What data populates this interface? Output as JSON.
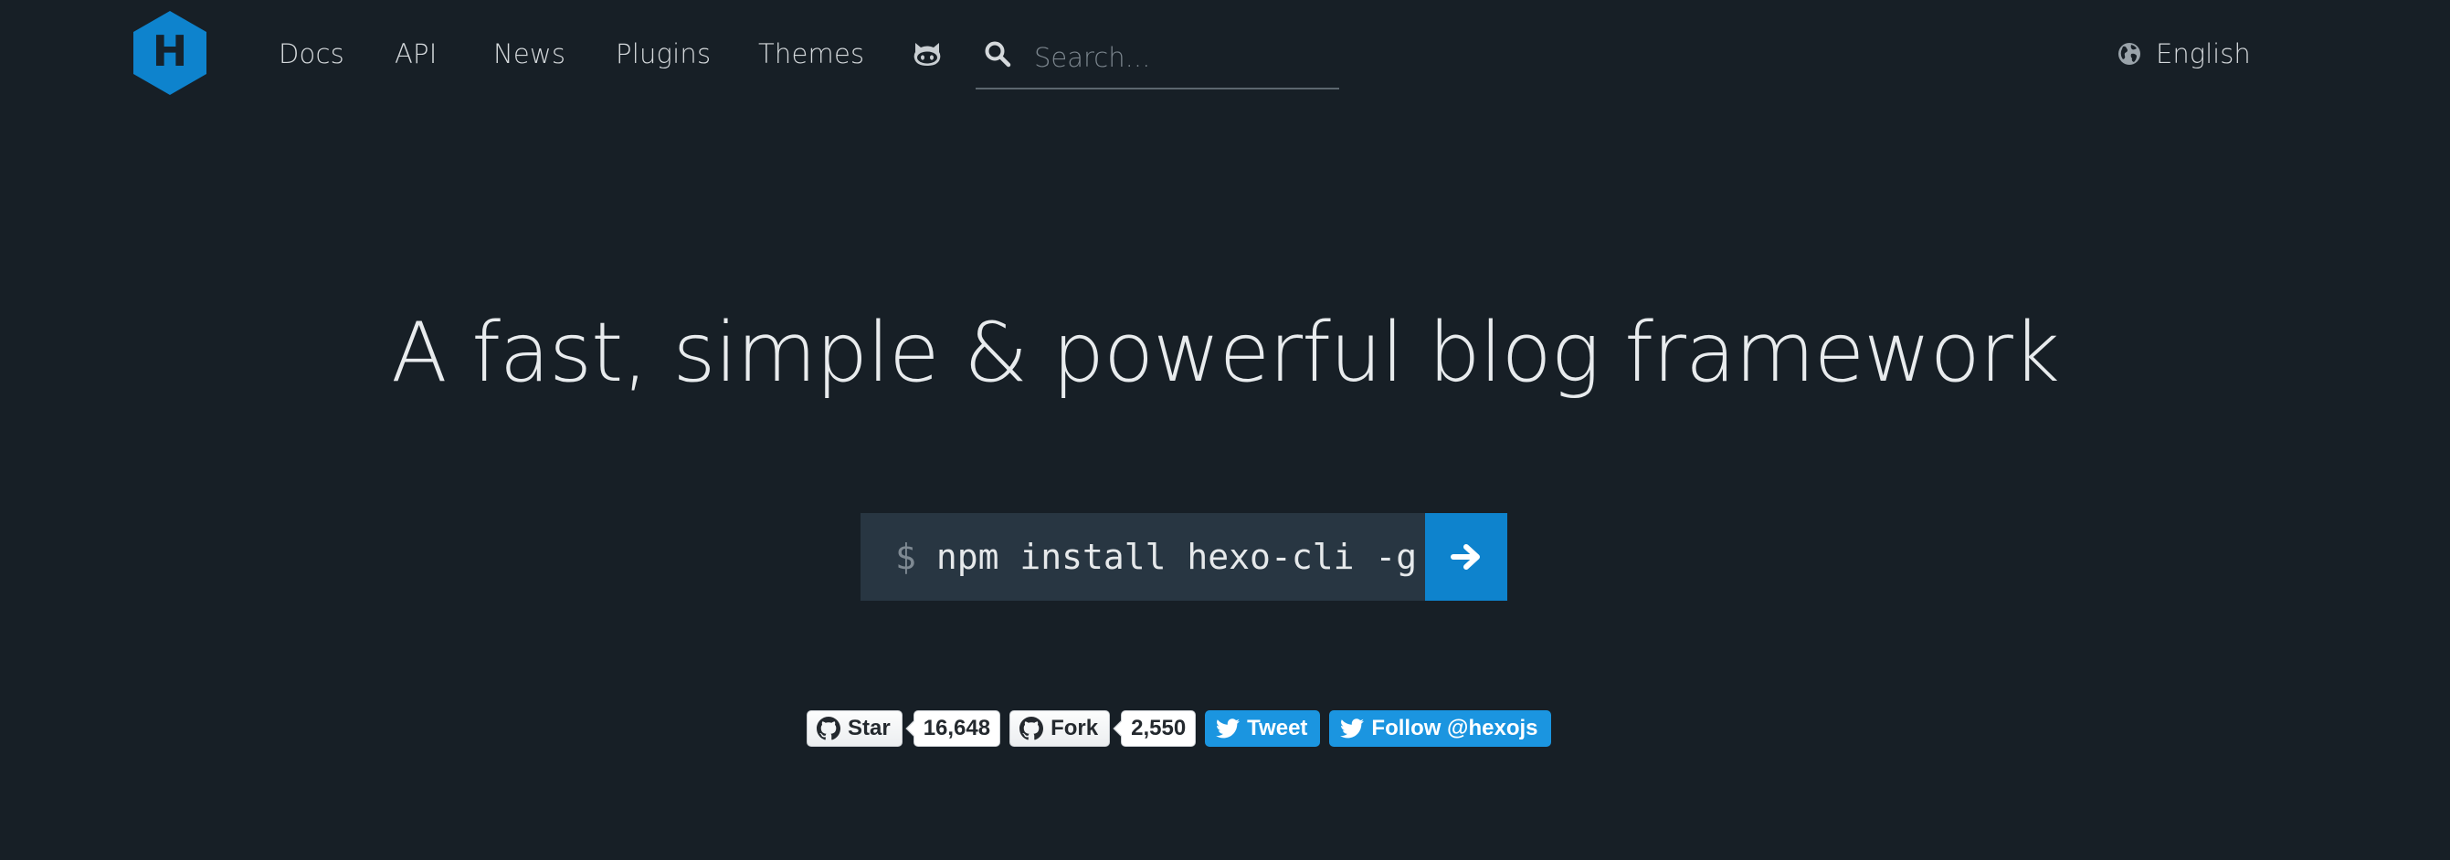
{
  "header": {
    "logo_letter": "H",
    "nav": [
      {
        "label": "Docs"
      },
      {
        "label": "API"
      },
      {
        "label": "News"
      },
      {
        "label": "Plugins"
      },
      {
        "label": "Themes"
      }
    ],
    "github_icon": "github-cat-icon",
    "search": {
      "placeholder": "Search...",
      "icon": "search-icon"
    },
    "language": {
      "label": "English",
      "icon": "globe-icon"
    }
  },
  "hero": {
    "title": "A fast, simple & powerful blog framework",
    "install": {
      "prompt": "$",
      "command": "npm install hexo-cli -g",
      "go_icon": "arrow-right-icon"
    }
  },
  "social": {
    "star_label": "Star",
    "star_count": "16,648",
    "fork_label": "Fork",
    "fork_count": "2,550",
    "tweet_label": "Tweet",
    "follow_label": "Follow @hexojs"
  },
  "colors": {
    "background": "#171f26",
    "accent": "#0e83cd",
    "command_bg": "#283642",
    "twitter": "#1b95e0"
  }
}
